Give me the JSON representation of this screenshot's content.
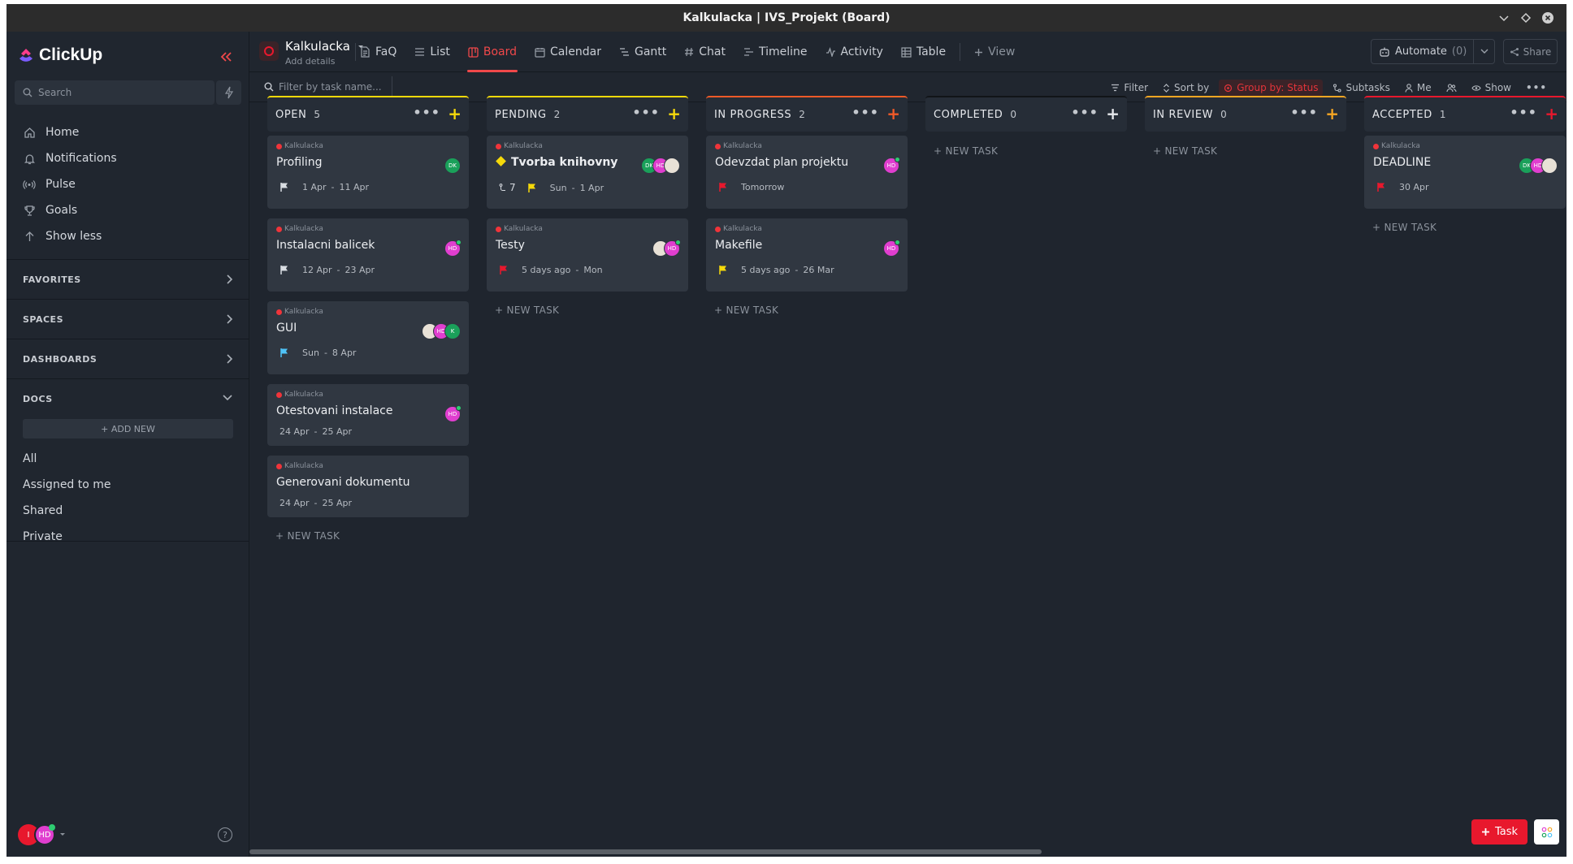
{
  "window": {
    "title": "Kalkulacka | IVS_Projekt (Board)"
  },
  "sidebar": {
    "logo": "ClickUp",
    "search_placeholder": "Search",
    "nav": [
      {
        "label": "Home",
        "icon": "home-icon"
      },
      {
        "label": "Notifications",
        "icon": "bell-icon"
      },
      {
        "label": "Pulse",
        "icon": "pulse-icon"
      },
      {
        "label": "Goals",
        "icon": "trophy-icon"
      },
      {
        "label": "Show less",
        "icon": "arrow-up-icon"
      }
    ],
    "sections": [
      "FAVORITES",
      "SPACES",
      "DASHBOARDS",
      "DOCS"
    ],
    "docs": {
      "add_new": "+ ADD NEW",
      "links": [
        "All",
        "Assigned to me",
        "Shared",
        "Private"
      ]
    },
    "user_avatars": [
      {
        "initials": "I",
        "color": "#e8182d"
      },
      {
        "initials": "HD",
        "color": "#e03ecf"
      }
    ]
  },
  "header": {
    "list_name": "Kalkulacka",
    "list_sub": "Add details",
    "tabs": [
      {
        "label": "FaQ",
        "icon": "doc-icon"
      },
      {
        "label": "List",
        "icon": "list-icon"
      },
      {
        "label": "Board",
        "icon": "board-icon",
        "active": true
      },
      {
        "label": "Calendar",
        "icon": "calendar-icon"
      },
      {
        "label": "Gantt",
        "icon": "gantt-icon"
      },
      {
        "label": "Chat",
        "icon": "hash-icon"
      },
      {
        "label": "Timeline",
        "icon": "timeline-icon"
      },
      {
        "label": "Activity",
        "icon": "activity-icon"
      },
      {
        "label": "Table",
        "icon": "table-icon"
      },
      {
        "label": "View",
        "icon": "plus-icon"
      }
    ],
    "automate_label": "Automate",
    "automate_count": "(0)",
    "share_label": "Share"
  },
  "toolbar": {
    "filter_placeholder": "Filter by task name...",
    "filter": "Filter",
    "sort": "Sort by",
    "group": "Group by: Status",
    "subtasks": "Subtasks",
    "me": "Me",
    "show": "Show"
  },
  "board": {
    "new_task_label": "+ NEW TASK",
    "columns": [
      {
        "name": "OPEN",
        "count": "5",
        "color": "#f5d90a",
        "cards": [
          {
            "crumb": "Kalkulacka",
            "title": "Profiling",
            "flag": "#d9dde2",
            "start": "1 Apr",
            "end": "11 Apr",
            "avatars": [
              {
                "i": "DK",
                "c": "#1aa05a"
              }
            ]
          },
          {
            "crumb": "Kalkulacka",
            "title": "Instalacni balicek",
            "flag": "#d9dde2",
            "start": "12 Apr",
            "end": "23 Apr",
            "avatars": [
              {
                "i": "HD",
                "c": "#e03ecf",
                "online": true
              }
            ]
          },
          {
            "crumb": "Kalkulacka",
            "title": "GUI",
            "flag": "#4fc3f7",
            "start": "Sun",
            "end": "8 Apr",
            "avatars": [
              {
                "i": "",
                "c": "#e8e1d6"
              },
              {
                "i": "HD",
                "c": "#e03ecf"
              },
              {
                "i": "K",
                "c": "#1aa05a"
              }
            ]
          },
          {
            "crumb": "Kalkulacka",
            "title": "Otestovani instalace",
            "start": "24 Apr",
            "end": "25 Apr",
            "avatars": [
              {
                "i": "HD",
                "c": "#e03ecf",
                "online": true
              }
            ]
          },
          {
            "crumb": "Kalkulacka",
            "title": "Generovani dokumentu",
            "start": "24 Apr",
            "end": "25 Apr",
            "avatars": []
          }
        ]
      },
      {
        "name": "PENDING",
        "count": "2",
        "color": "#f5d90a",
        "cards": [
          {
            "crumb": "Kalkulacka",
            "title": "Tvorba knihovny",
            "bold": true,
            "subtasks": "7",
            "flag": "#f5d90a",
            "start": "Sun",
            "end": "1 Apr",
            "avatars": [
              {
                "i": "DK",
                "c": "#1aa05a"
              },
              {
                "i": "HD",
                "c": "#e03ecf"
              },
              {
                "i": "",
                "c": "#e8e1d6"
              }
            ]
          },
          {
            "crumb": "Kalkulacka",
            "title": "Testy",
            "flag": "#e8182d",
            "start": "5 days ago",
            "end": "Mon",
            "avatars": [
              {
                "i": "",
                "c": "#e8e1d6"
              },
              {
                "i": "HD",
                "c": "#e03ecf",
                "online": true
              }
            ]
          }
        ]
      },
      {
        "name": "IN PROGRESS",
        "count": "2",
        "color": "#f05a28",
        "cards": [
          {
            "crumb": "Kalkulacka",
            "title": "Odevzdat plan projektu",
            "flag": "#e8182d",
            "start": "",
            "end": "Tomorrow",
            "avatars": [
              {
                "i": "HD",
                "c": "#e03ecf",
                "online": true
              }
            ]
          },
          {
            "crumb": "Kalkulacka",
            "title": "Makefile",
            "flag": "#f5d90a",
            "start": "5 days ago",
            "end": "26 Mar",
            "avatars": [
              {
                "i": "HD",
                "c": "#e03ecf",
                "online": true
              }
            ]
          }
        ]
      },
      {
        "name": "COMPLETED",
        "count": "0",
        "color": "#111418",
        "cards": []
      },
      {
        "name": "IN REVIEW",
        "count": "0",
        "color": "#f5a623",
        "cards": []
      },
      {
        "name": "ACCEPTED",
        "count": "1",
        "color": "#e8182d",
        "cards": [
          {
            "crumb": "Kalkulacka",
            "title": "DEADLINE",
            "flag": "#e8182d",
            "start": "",
            "end": "30 Apr",
            "avatars": [
              {
                "i": "DK",
                "c": "#1aa05a"
              },
              {
                "i": "HD",
                "c": "#e03ecf"
              },
              {
                "i": "",
                "c": "#e8e1d6"
              }
            ]
          }
        ]
      }
    ]
  },
  "fab": {
    "task_label": "Task"
  }
}
